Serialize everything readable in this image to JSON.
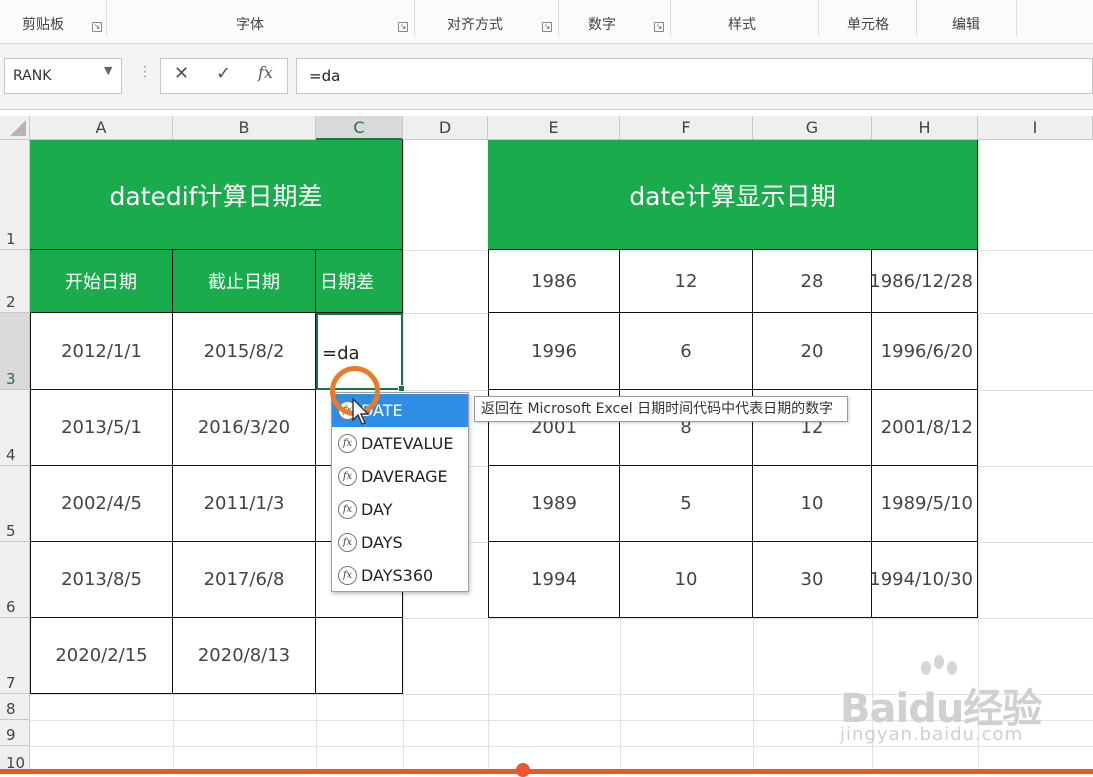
{
  "ribbon": {
    "groups": [
      "剪贴板",
      "字体",
      "对齐方式",
      "数字",
      "样式",
      "单元格",
      "编辑"
    ]
  },
  "formula_bar": {
    "name_box": "RANK",
    "cancel_icon": "✕",
    "enter_icon": "✓",
    "fx_icon": "fx",
    "value": "=da"
  },
  "columns": [
    "A",
    "B",
    "C",
    "D",
    "E",
    "F",
    "G",
    "H",
    "I"
  ],
  "rows": [
    "1",
    "2",
    "3",
    "4",
    "5",
    "6",
    "7",
    "8",
    "9",
    "10"
  ],
  "table1": {
    "title": "datedif计算日期差",
    "headers": [
      "开始日期",
      "截止日期",
      "日期差"
    ],
    "data": [
      [
        "2012/1/1",
        "2015/8/2",
        "=da"
      ],
      [
        "2013/5/1",
        "2016/3/20",
        ""
      ],
      [
        "2002/4/5",
        "2011/1/3",
        ""
      ],
      [
        "2013/8/5",
        "2017/6/8",
        ""
      ],
      [
        "2020/2/15",
        "2020/8/13",
        ""
      ]
    ]
  },
  "table2": {
    "title": "date计算显示日期",
    "data": [
      [
        "1986",
        "12",
        "28",
        "1986/12/28"
      ],
      [
        "1996",
        "6",
        "20",
        "1996/6/20"
      ],
      [
        "2001",
        "8",
        "12",
        "2001/8/12"
      ],
      [
        "1989",
        "5",
        "10",
        "1989/5/10"
      ],
      [
        "1994",
        "10",
        "30",
        "1994/10/30"
      ]
    ]
  },
  "autocomplete": {
    "items": [
      "DATE",
      "DATEVALUE",
      "DAVERAGE",
      "DAY",
      "DAYS",
      "DAYS360"
    ],
    "selected_index": 0,
    "tooltip": "返回在 Microsoft Excel 日期时间代码中代表日期的数字"
  },
  "watermark": {
    "logo": "Baidu经验",
    "url": "jingyan.baidu.com"
  },
  "colors": {
    "header_green": "#1aab4d",
    "selection_green": "#1e7145",
    "autocomplete_blue": "#2f8de4",
    "cursor_ring": "#e97b28"
  }
}
